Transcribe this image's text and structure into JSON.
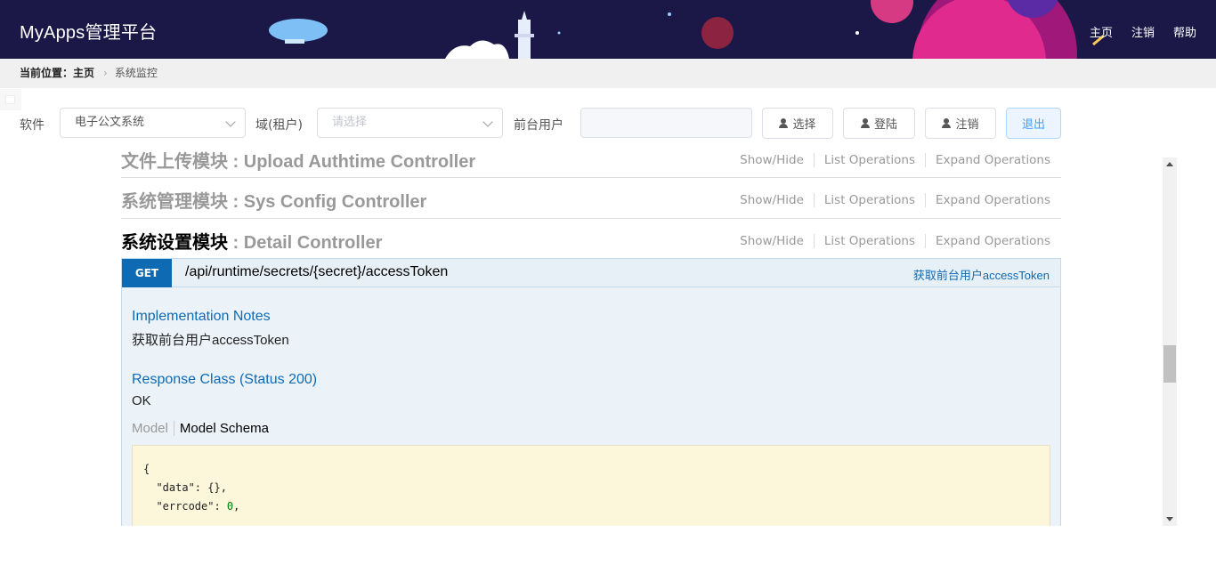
{
  "header": {
    "brand": "MyApps管理平台",
    "nav": [
      "主页",
      "注销",
      "帮助"
    ]
  },
  "breadcrumb": {
    "label": "当前位置：",
    "home": "主页",
    "current": "系统监控"
  },
  "toolbar": {
    "software_label": "软件",
    "software_value": "电子公文系统",
    "domain_label": "域(租户)",
    "domain_placeholder": "请选择",
    "user_label": "前台用户",
    "user_value": "",
    "select_btn": "选择",
    "login_btn": "登陆",
    "logout_btn": "注销",
    "exit_btn": "退出"
  },
  "resources": [
    {
      "title_cn": "文件上传模块",
      "title_en": " : Upload Authtime Controller"
    },
    {
      "title_cn": "系统管理模块",
      "title_en": " : Sys Config Controller"
    },
    {
      "title_cn": "系统设置模块",
      "title_en": " : Detail Controller"
    }
  ],
  "ops_labels": {
    "show_hide": "Show/Hide",
    "list": "List Operations",
    "expand": "Expand Operations"
  },
  "operation": {
    "method": "GET",
    "path": "/api/runtime/secrets/{secret}/accessToken",
    "summary": "获取前台用户accessToken",
    "impl_notes_title": "Implementation Notes",
    "impl_notes": "获取前台用户accessToken",
    "response_title": "Response Class (Status 200)",
    "response": "OK",
    "tab_model": "Model",
    "tab_schema": "Model Schema",
    "schema_line1": "{",
    "schema_line2": "  \"data\": {},",
    "schema_line3_key": "  \"errcode\": ",
    "schema_line3_val": "0",
    "schema_line3_end": ","
  },
  "colors": {
    "header_bg": "#1b1848",
    "get_badge": "#0f6ab4",
    "exit_btn_bg": "#ecf5ff"
  }
}
